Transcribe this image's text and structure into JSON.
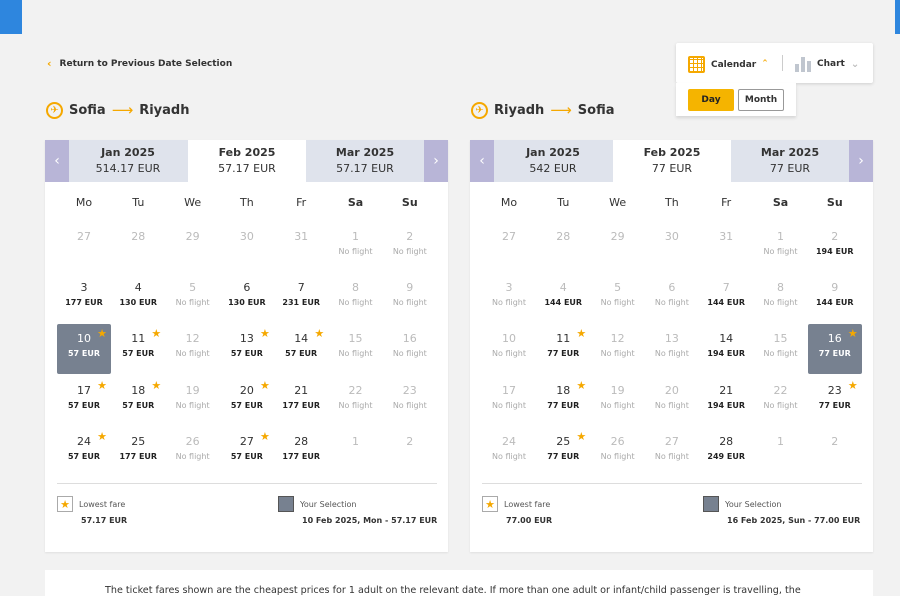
{
  "back_label": "Return to Previous Date Selection",
  "view_toggle": {
    "calendar_label": "Calendar",
    "chart_label": "Chart",
    "day_label": "Day",
    "month_label": "Month"
  },
  "weekdays": [
    "Mo",
    "Tu",
    "We",
    "Th",
    "Fr",
    "Sa",
    "Su"
  ],
  "outbound": {
    "from": "Sofia",
    "to": "Riyadh",
    "months": [
      {
        "name": "Jan 2025",
        "price": "514.17 EUR"
      },
      {
        "name": "Feb 2025",
        "price": "57.17 EUR"
      },
      {
        "name": "Mar 2025",
        "price": "57.17 EUR"
      }
    ],
    "days": [
      {
        "d": "27",
        "p": "",
        "gray": true
      },
      {
        "d": "28",
        "p": "",
        "gray": true
      },
      {
        "d": "29",
        "p": "",
        "gray": true
      },
      {
        "d": "30",
        "p": "",
        "gray": true
      },
      {
        "d": "31",
        "p": "",
        "gray": true
      },
      {
        "d": "1",
        "p": "No flight",
        "gray": true
      },
      {
        "d": "2",
        "p": "No flight",
        "gray": true
      },
      {
        "d": "3",
        "p": "177 EUR"
      },
      {
        "d": "4",
        "p": "130 EUR"
      },
      {
        "d": "5",
        "p": "No flight",
        "gray": true
      },
      {
        "d": "6",
        "p": "130 EUR"
      },
      {
        "d": "7",
        "p": "231 EUR"
      },
      {
        "d": "8",
        "p": "No flight",
        "gray": true
      },
      {
        "d": "9",
        "p": "No flight",
        "gray": true
      },
      {
        "d": "10",
        "p": "57 EUR",
        "star": true,
        "sel": true
      },
      {
        "d": "11",
        "p": "57 EUR",
        "star": true
      },
      {
        "d": "12",
        "p": "No flight",
        "gray": true
      },
      {
        "d": "13",
        "p": "57 EUR",
        "star": true
      },
      {
        "d": "14",
        "p": "57 EUR",
        "star": true
      },
      {
        "d": "15",
        "p": "No flight",
        "gray": true
      },
      {
        "d": "16",
        "p": "No flight",
        "gray": true
      },
      {
        "d": "17",
        "p": "57 EUR",
        "star": true
      },
      {
        "d": "18",
        "p": "57 EUR",
        "star": true
      },
      {
        "d": "19",
        "p": "No flight",
        "gray": true
      },
      {
        "d": "20",
        "p": "57 EUR",
        "star": true
      },
      {
        "d": "21",
        "p": "177 EUR"
      },
      {
        "d": "22",
        "p": "No flight",
        "gray": true
      },
      {
        "d": "23",
        "p": "No flight",
        "gray": true
      },
      {
        "d": "24",
        "p": "57 EUR",
        "star": true
      },
      {
        "d": "25",
        "p": "177 EUR"
      },
      {
        "d": "26",
        "p": "No flight",
        "gray": true
      },
      {
        "d": "27",
        "p": "57 EUR",
        "star": true
      },
      {
        "d": "28",
        "p": "177 EUR"
      },
      {
        "d": "1",
        "p": "",
        "gray": true
      },
      {
        "d": "2",
        "p": "",
        "gray": true
      }
    ],
    "legend": {
      "lowest_label": "Lowest fare",
      "lowest_value": "57.17 EUR",
      "selection_label": "Your Selection",
      "selection_value": "10 Feb 2025, Mon - 57.17 EUR"
    }
  },
  "inbound": {
    "from": "Riyadh",
    "to": "Sofia",
    "months": [
      {
        "name": "Jan 2025",
        "price": "542 EUR"
      },
      {
        "name": "Feb 2025",
        "price": "77 EUR"
      },
      {
        "name": "Mar 2025",
        "price": "77 EUR"
      }
    ],
    "days": [
      {
        "d": "27",
        "p": "",
        "gray": true
      },
      {
        "d": "28",
        "p": "",
        "gray": true
      },
      {
        "d": "29",
        "p": "",
        "gray": true
      },
      {
        "d": "30",
        "p": "",
        "gray": true
      },
      {
        "d": "31",
        "p": "",
        "gray": true
      },
      {
        "d": "1",
        "p": "No flight",
        "gray": true
      },
      {
        "d": "2",
        "p": "194 EUR",
        "gray": true
      },
      {
        "d": "3",
        "p": "No flight",
        "gray": true
      },
      {
        "d": "4",
        "p": "144 EUR",
        "gray": true
      },
      {
        "d": "5",
        "p": "No flight",
        "gray": true
      },
      {
        "d": "6",
        "p": "No flight",
        "gray": true
      },
      {
        "d": "7",
        "p": "144 EUR",
        "gray": true
      },
      {
        "d": "8",
        "p": "No flight",
        "gray": true
      },
      {
        "d": "9",
        "p": "144 EUR",
        "gray": true
      },
      {
        "d": "10",
        "p": "No flight",
        "gray": true
      },
      {
        "d": "11",
        "p": "77 EUR",
        "star": true
      },
      {
        "d": "12",
        "p": "No flight",
        "gray": true
      },
      {
        "d": "13",
        "p": "No flight",
        "gray": true
      },
      {
        "d": "14",
        "p": "194 EUR"
      },
      {
        "d": "15",
        "p": "No flight",
        "gray": true
      },
      {
        "d": "16",
        "p": "77 EUR",
        "star": true,
        "sel": true
      },
      {
        "d": "17",
        "p": "No flight",
        "gray": true
      },
      {
        "d": "18",
        "p": "77 EUR",
        "star": true
      },
      {
        "d": "19",
        "p": "No flight",
        "gray": true
      },
      {
        "d": "20",
        "p": "No flight",
        "gray": true
      },
      {
        "d": "21",
        "p": "194 EUR"
      },
      {
        "d": "22",
        "p": "No flight",
        "gray": true
      },
      {
        "d": "23",
        "p": "77 EUR",
        "star": true
      },
      {
        "d": "24",
        "p": "No flight",
        "gray": true
      },
      {
        "d": "25",
        "p": "77 EUR",
        "star": true
      },
      {
        "d": "26",
        "p": "No flight",
        "gray": true
      },
      {
        "d": "27",
        "p": "No flight",
        "gray": true
      },
      {
        "d": "28",
        "p": "249 EUR"
      },
      {
        "d": "1",
        "p": "",
        "gray": true
      },
      {
        "d": "2",
        "p": "",
        "gray": true
      }
    ],
    "legend": {
      "lowest_label": "Lowest fare",
      "lowest_value": "77.00 EUR",
      "selection_label": "Your Selection",
      "selection_value": "16 Feb 2025, Sun - 77.00 EUR"
    }
  },
  "note": "The ticket fares shown are the cheapest prices for 1 adult on the relevant date. If more than one adult or infant/child passenger is travelling, the"
}
